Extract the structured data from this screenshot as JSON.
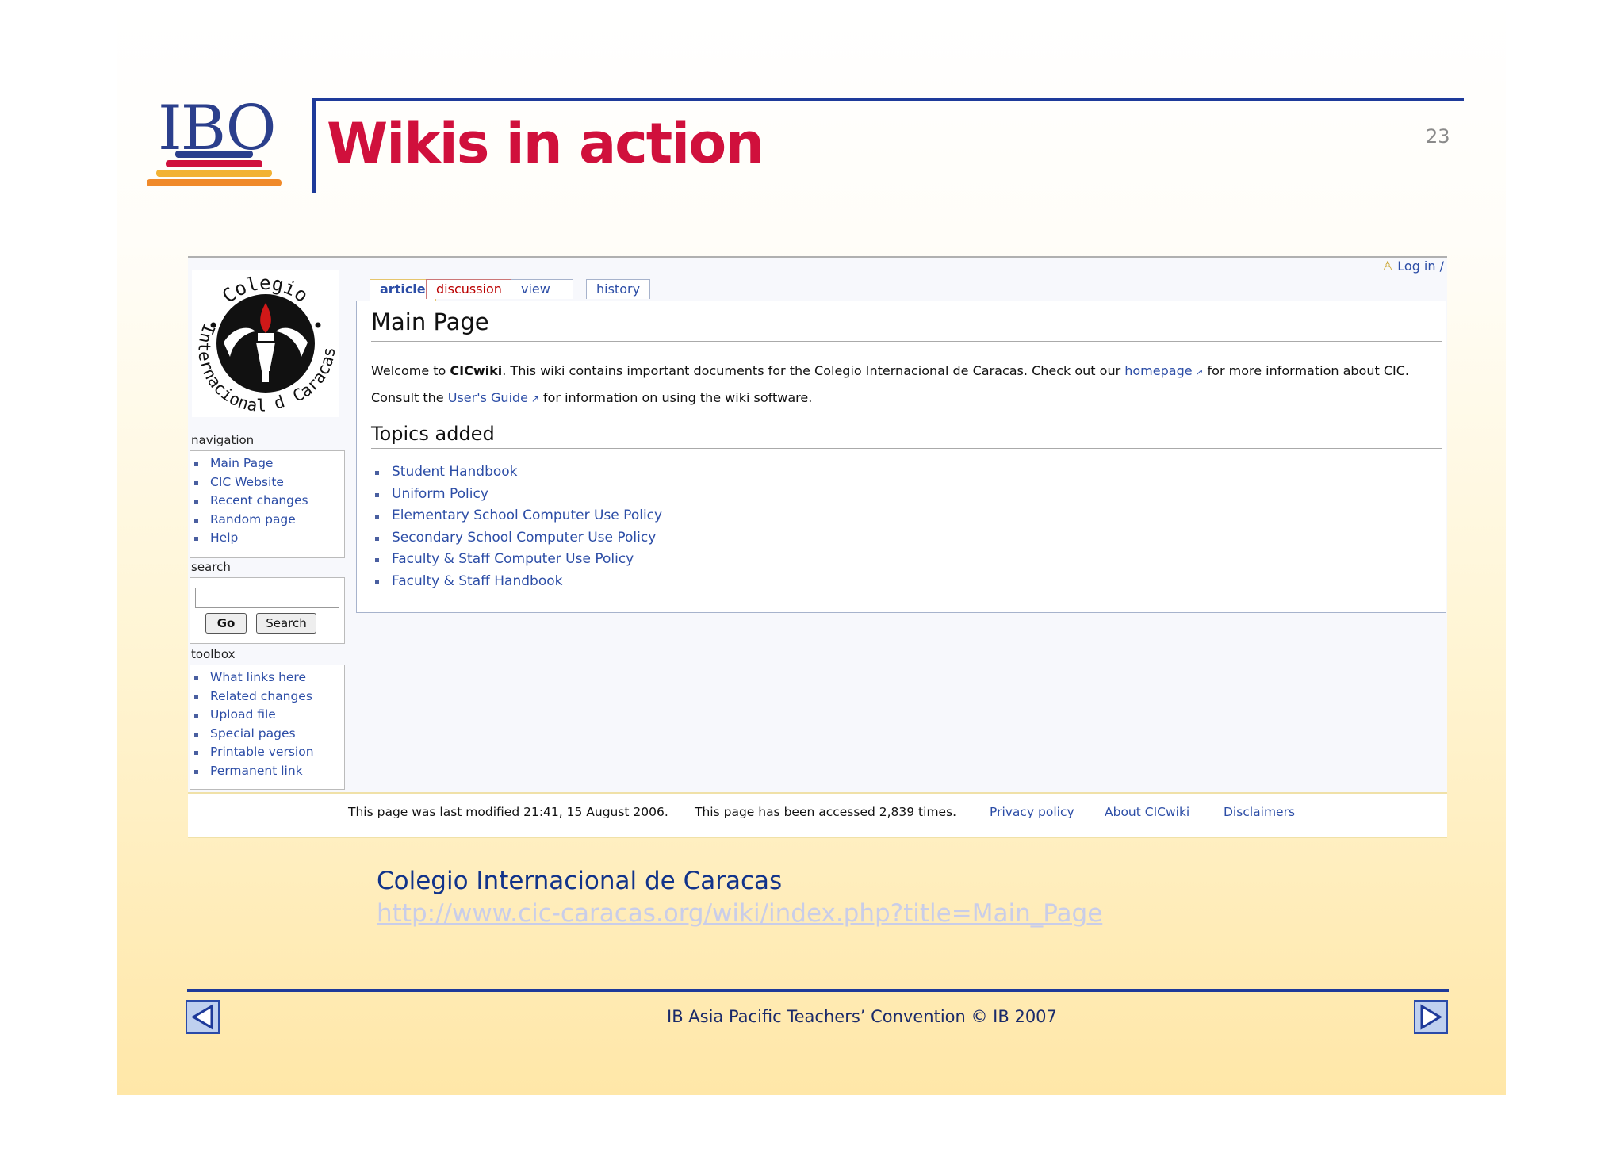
{
  "slide": {
    "logo_text": "IBO",
    "title": "Wikis in action",
    "page_number": "23",
    "caption": "Colegio Internacional de Caracas",
    "caption_url": "http://www.cic-caracas.org/wiki/index.php?title=Main_Page",
    "footer": "IB Asia Pacific Teachers’ Convention © IB 2007",
    "colors": {
      "title_red": "#d0103c",
      "accent_blue": "#1e3a9a"
    },
    "nav": {
      "prev_icon": "arrow-left-icon",
      "next_icon": "arrow-right-icon"
    }
  },
  "wiki": {
    "logo_text": {
      "top": "Colegio",
      "left": "Internacional de",
      "right": "Caracas",
      "circle": "Colegio • Internacional de Caracas"
    },
    "login": "Log in /",
    "tabs": [
      "article",
      "discussion",
      "view source",
      "history"
    ],
    "page_title": "Main Page",
    "welcome": {
      "pre": "Welcome to ",
      "bold": "CICwiki",
      "mid": ". This wiki contains important documents for the Colegio Internacional de Caracas. Check out our ",
      "link": "homepage",
      "post": " for more information about CIC."
    },
    "consult": {
      "pre": "Consult the ",
      "link": "User's Guide",
      "post": " for information on using the wiki software."
    },
    "topics_heading": "Topics added",
    "topics": [
      "Student Handbook",
      "Uniform Policy",
      "Elementary School Computer Use Policy",
      "Secondary School Computer Use Policy",
      "Faculty & Staff Computer Use Policy",
      "Faculty & Staff Handbook"
    ],
    "navigation": {
      "title": "navigation",
      "items": [
        "Main Page",
        "CIC Website",
        "Recent changes",
        "Random page",
        "Help"
      ]
    },
    "search": {
      "title": "search",
      "go": "Go",
      "search": "Search",
      "value": ""
    },
    "toolbox": {
      "title": "toolbox",
      "items": [
        "What links here",
        "Related changes",
        "Upload file",
        "Special pages",
        "Printable version",
        "Permanent link"
      ]
    },
    "footer": {
      "modified": "This page was last modified 21:41, 15 August 2006.",
      "accessed": "This page has been accessed 2,839 times.",
      "privacy": "Privacy policy",
      "about": "About CICwiki",
      "disclaimers": "Disclaimers"
    }
  }
}
